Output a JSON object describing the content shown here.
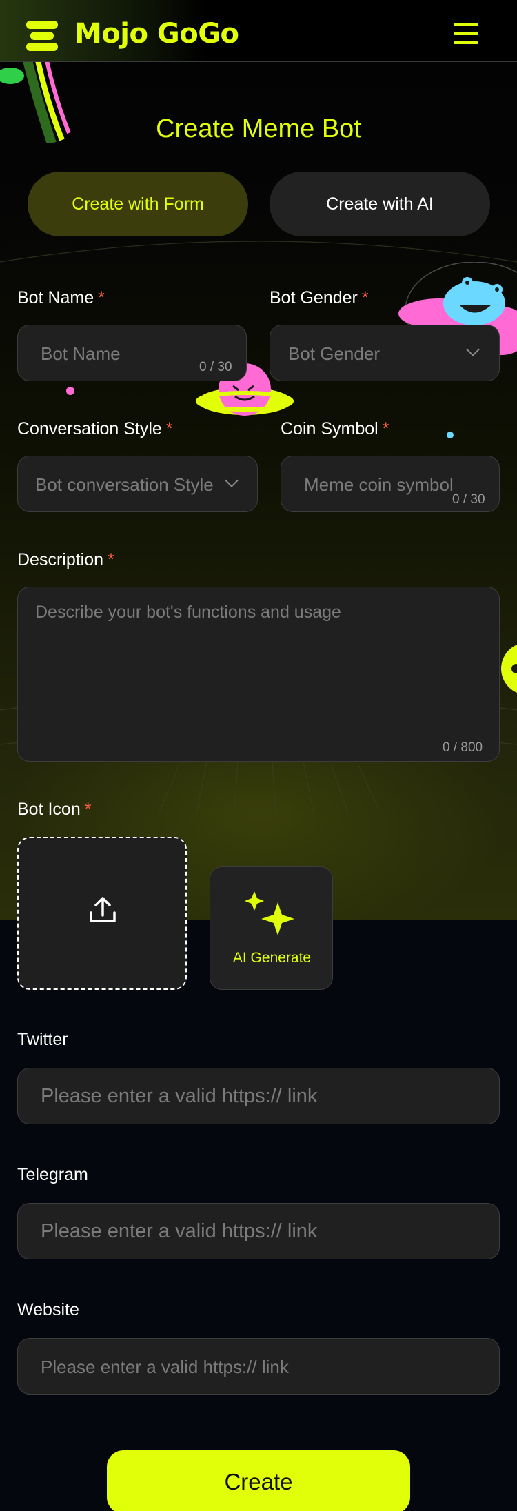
{
  "header": {
    "app_name": "Mojo GoGo"
  },
  "page_title": "Create Meme Bot",
  "tabs": [
    {
      "label": "Create with Form",
      "active": true
    },
    {
      "label": "Create with AI",
      "active": false
    }
  ],
  "form": {
    "required_mark": "*",
    "bot_name": {
      "label": "Bot Name",
      "placeholder": "Bot Name",
      "counter": "0 / 30"
    },
    "bot_gender": {
      "label": "Bot Gender",
      "placeholder": "Bot Gender"
    },
    "conversation_style": {
      "label": "Conversation Style",
      "placeholder": "Bot conversation Style"
    },
    "coin_symbol": {
      "label": "Coin Symbol",
      "placeholder": "Meme coin symbol",
      "counter": "0 / 30"
    },
    "description": {
      "label": "Description",
      "placeholder": "Describe your bot's functions and usage",
      "counter": "0 / 800"
    },
    "bot_icon": {
      "label": "Bot Icon",
      "ai_generate_label": "AI Generate"
    },
    "twitter": {
      "label": "Twitter",
      "placeholder": "Please enter a valid https:// link"
    },
    "telegram": {
      "label": "Telegram",
      "placeholder": "Please enter a valid https:// link"
    },
    "website": {
      "label": "Website",
      "placeholder": "Please enter a valid https:// link"
    }
  },
  "create_label": "Create",
  "icons": [
    "logo-icon",
    "hamburger-menu-icon",
    "chevron-down-icon",
    "upload-icon",
    "sparkle-icon"
  ],
  "colors": {
    "accent": "#e2ff0a",
    "required": "#ff5f45",
    "field_bg": "#202020",
    "page_bg": "#05070f"
  }
}
